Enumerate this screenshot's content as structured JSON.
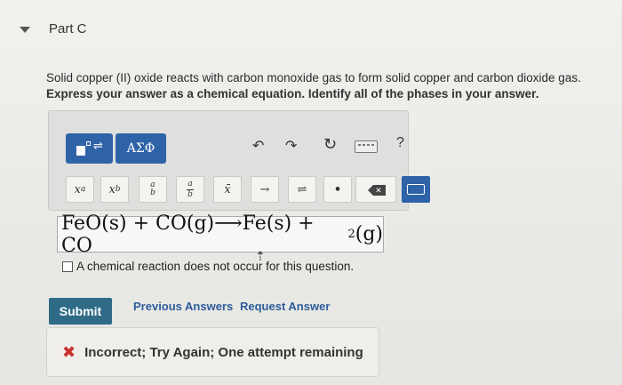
{
  "part": {
    "title": "Part C"
  },
  "question": {
    "text": "Solid copper (II) oxide reacts with carbon monoxide gas to form solid copper and carbon dioxide gas.",
    "instruction": "Express your answer as a chemical equation. Identify all of the phases in your answer."
  },
  "toolbar": {
    "greek_label": "ΑΣΦ",
    "help_label": "?",
    "symbols": [
      "x^a",
      "x_b",
      "a/b (stacked)",
      "a/b (fraction)",
      "x̄",
      "→",
      "⇌",
      "•"
    ]
  },
  "answer": {
    "prefix": "FeO(s) + CO(g)⟶Fe(s) + CO",
    "subscript": "2",
    "suffix": "(g)"
  },
  "no_reaction": {
    "label": "A chemical reaction does not occur for this question.",
    "checked": false
  },
  "actions": {
    "submit": "Submit",
    "previous": "Previous Answers",
    "request": "Request Answer"
  },
  "feedback": {
    "text": "Incorrect; Try Again; One attempt remaining",
    "status_color": "#c9302c"
  }
}
